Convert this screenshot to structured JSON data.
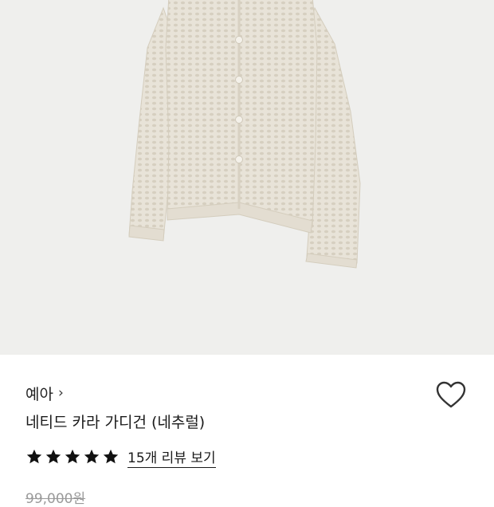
{
  "product": {
    "brand": "예아",
    "brand_chevron": "›",
    "name": "네티드 카라 가디건 (네추럴)",
    "rating_stars": 5,
    "review_link": "15개 리뷰 보기",
    "original_price": "99,000원"
  },
  "colors": {
    "hero_background": "#efefed",
    "garment": "#e6e1d6",
    "garment_shadow": "#cfc8b9",
    "star": "#111111",
    "heart_outline": "#333333"
  },
  "icons": {
    "brand_chevron": "chevron-right-icon",
    "wishlist": "heart-outline-icon",
    "star": "star-filled-icon"
  }
}
